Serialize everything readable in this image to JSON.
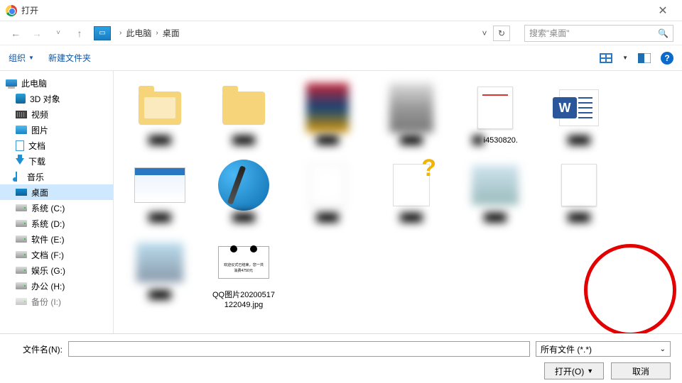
{
  "window": {
    "title": "打开"
  },
  "nav": {
    "crumbs": [
      "此电脑",
      "桌面"
    ],
    "search_placeholder": "搜索\"桌面\""
  },
  "toolbar": {
    "organize": "组织",
    "new_folder": "新建文件夹"
  },
  "sidebar": {
    "items": [
      {
        "label": "此电脑",
        "icon": "pc",
        "top": true
      },
      {
        "label": "3D 对象",
        "icon": "3d"
      },
      {
        "label": "视频",
        "icon": "video"
      },
      {
        "label": "图片",
        "icon": "img"
      },
      {
        "label": "文档",
        "icon": "doc"
      },
      {
        "label": "下载",
        "icon": "down"
      },
      {
        "label": "音乐",
        "icon": "music"
      },
      {
        "label": "桌面",
        "icon": "desk",
        "selected": true
      },
      {
        "label": "系统 (C:)",
        "icon": "drive"
      },
      {
        "label": "系统 (D:)",
        "icon": "drive"
      },
      {
        "label": "软件 (E:)",
        "icon": "drive"
      },
      {
        "label": "文档 (F:)",
        "icon": "drive"
      },
      {
        "label": "娱乐 (G:)",
        "icon": "drive"
      },
      {
        "label": "办公 (H:)",
        "icon": "drive"
      },
      {
        "label": "备份 (I:)",
        "icon": "drive"
      }
    ]
  },
  "files": {
    "row1": [
      {
        "name": "",
        "kind": "folder"
      },
      {
        "name": "",
        "kind": "folder"
      },
      {
        "name": "",
        "kind": "blurimg"
      },
      {
        "name": "",
        "kind": "blurimg"
      },
      {
        "name": "i4530820.",
        "kind": "paper-red"
      },
      {
        "name": "",
        "kind": "word"
      },
      {
        "name": "",
        "kind": "screenshot"
      }
    ],
    "row2": [
      {
        "name": "",
        "kind": "penball"
      },
      {
        "name": "",
        "kind": "blurpaper"
      },
      {
        "name": "",
        "kind": "qmark"
      },
      {
        "name": "",
        "kind": "blurimg"
      },
      {
        "name": "",
        "kind": "paper"
      },
      {
        "name": "",
        "kind": "blurimg"
      }
    ],
    "highlighted": {
      "name": "QQ图片20200517122049.jpg",
      "caption_line1": "欢迎仪式已结束，您一共",
      "caption_line2": "消费4750元"
    }
  },
  "footer": {
    "filename_label": "文件名(N):",
    "filename_value": "",
    "filter_label": "所有文件 (*.*)",
    "open_button": "打开(O)",
    "cancel_button": "取消"
  }
}
